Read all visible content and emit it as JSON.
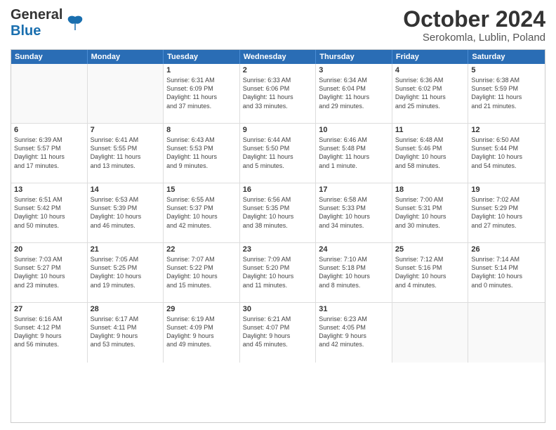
{
  "header": {
    "logo_general": "General",
    "logo_blue": "Blue",
    "month_title": "October 2024",
    "location": "Serokomla, Lublin, Poland"
  },
  "days_of_week": [
    "Sunday",
    "Monday",
    "Tuesday",
    "Wednesday",
    "Thursday",
    "Friday",
    "Saturday"
  ],
  "weeks": [
    [
      {
        "day": "",
        "info": ""
      },
      {
        "day": "",
        "info": ""
      },
      {
        "day": "1",
        "info": "Sunrise: 6:31 AM\nSunset: 6:09 PM\nDaylight: 11 hours\nand 37 minutes."
      },
      {
        "day": "2",
        "info": "Sunrise: 6:33 AM\nSunset: 6:06 PM\nDaylight: 11 hours\nand 33 minutes."
      },
      {
        "day": "3",
        "info": "Sunrise: 6:34 AM\nSunset: 6:04 PM\nDaylight: 11 hours\nand 29 minutes."
      },
      {
        "day": "4",
        "info": "Sunrise: 6:36 AM\nSunset: 6:02 PM\nDaylight: 11 hours\nand 25 minutes."
      },
      {
        "day": "5",
        "info": "Sunrise: 6:38 AM\nSunset: 5:59 PM\nDaylight: 11 hours\nand 21 minutes."
      }
    ],
    [
      {
        "day": "6",
        "info": "Sunrise: 6:39 AM\nSunset: 5:57 PM\nDaylight: 11 hours\nand 17 minutes."
      },
      {
        "day": "7",
        "info": "Sunrise: 6:41 AM\nSunset: 5:55 PM\nDaylight: 11 hours\nand 13 minutes."
      },
      {
        "day": "8",
        "info": "Sunrise: 6:43 AM\nSunset: 5:53 PM\nDaylight: 11 hours\nand 9 minutes."
      },
      {
        "day": "9",
        "info": "Sunrise: 6:44 AM\nSunset: 5:50 PM\nDaylight: 11 hours\nand 5 minutes."
      },
      {
        "day": "10",
        "info": "Sunrise: 6:46 AM\nSunset: 5:48 PM\nDaylight: 11 hours\nand 1 minute."
      },
      {
        "day": "11",
        "info": "Sunrise: 6:48 AM\nSunset: 5:46 PM\nDaylight: 10 hours\nand 58 minutes."
      },
      {
        "day": "12",
        "info": "Sunrise: 6:50 AM\nSunset: 5:44 PM\nDaylight: 10 hours\nand 54 minutes."
      }
    ],
    [
      {
        "day": "13",
        "info": "Sunrise: 6:51 AM\nSunset: 5:42 PM\nDaylight: 10 hours\nand 50 minutes."
      },
      {
        "day": "14",
        "info": "Sunrise: 6:53 AM\nSunset: 5:39 PM\nDaylight: 10 hours\nand 46 minutes."
      },
      {
        "day": "15",
        "info": "Sunrise: 6:55 AM\nSunset: 5:37 PM\nDaylight: 10 hours\nand 42 minutes."
      },
      {
        "day": "16",
        "info": "Sunrise: 6:56 AM\nSunset: 5:35 PM\nDaylight: 10 hours\nand 38 minutes."
      },
      {
        "day": "17",
        "info": "Sunrise: 6:58 AM\nSunset: 5:33 PM\nDaylight: 10 hours\nand 34 minutes."
      },
      {
        "day": "18",
        "info": "Sunrise: 7:00 AM\nSunset: 5:31 PM\nDaylight: 10 hours\nand 30 minutes."
      },
      {
        "day": "19",
        "info": "Sunrise: 7:02 AM\nSunset: 5:29 PM\nDaylight: 10 hours\nand 27 minutes."
      }
    ],
    [
      {
        "day": "20",
        "info": "Sunrise: 7:03 AM\nSunset: 5:27 PM\nDaylight: 10 hours\nand 23 minutes."
      },
      {
        "day": "21",
        "info": "Sunrise: 7:05 AM\nSunset: 5:25 PM\nDaylight: 10 hours\nand 19 minutes."
      },
      {
        "day": "22",
        "info": "Sunrise: 7:07 AM\nSunset: 5:22 PM\nDaylight: 10 hours\nand 15 minutes."
      },
      {
        "day": "23",
        "info": "Sunrise: 7:09 AM\nSunset: 5:20 PM\nDaylight: 10 hours\nand 11 minutes."
      },
      {
        "day": "24",
        "info": "Sunrise: 7:10 AM\nSunset: 5:18 PM\nDaylight: 10 hours\nand 8 minutes."
      },
      {
        "day": "25",
        "info": "Sunrise: 7:12 AM\nSunset: 5:16 PM\nDaylight: 10 hours\nand 4 minutes."
      },
      {
        "day": "26",
        "info": "Sunrise: 7:14 AM\nSunset: 5:14 PM\nDaylight: 10 hours\nand 0 minutes."
      }
    ],
    [
      {
        "day": "27",
        "info": "Sunrise: 6:16 AM\nSunset: 4:12 PM\nDaylight: 9 hours\nand 56 minutes."
      },
      {
        "day": "28",
        "info": "Sunrise: 6:17 AM\nSunset: 4:11 PM\nDaylight: 9 hours\nand 53 minutes."
      },
      {
        "day": "29",
        "info": "Sunrise: 6:19 AM\nSunset: 4:09 PM\nDaylight: 9 hours\nand 49 minutes."
      },
      {
        "day": "30",
        "info": "Sunrise: 6:21 AM\nSunset: 4:07 PM\nDaylight: 9 hours\nand 45 minutes."
      },
      {
        "day": "31",
        "info": "Sunrise: 6:23 AM\nSunset: 4:05 PM\nDaylight: 9 hours\nand 42 minutes."
      },
      {
        "day": "",
        "info": ""
      },
      {
        "day": "",
        "info": ""
      }
    ]
  ]
}
